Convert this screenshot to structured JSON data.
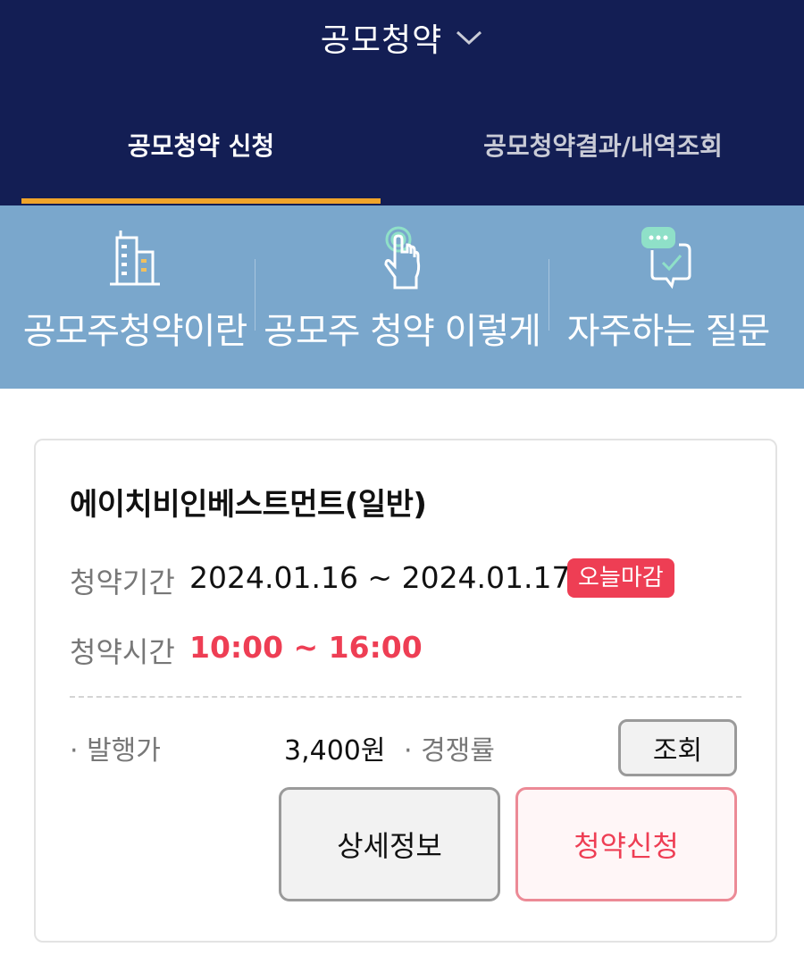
{
  "header": {
    "title": "공모청약",
    "title_icon": "chevron-down-icon",
    "tabs": [
      {
        "label": "공모청약 신청",
        "active": true
      },
      {
        "label": "공모청약결과/내역조회",
        "active": false
      }
    ],
    "accent_color": "#f0a42a",
    "background_color": "#131e54"
  },
  "quick_menu": {
    "background_color": "#7aa7cc",
    "items": [
      {
        "label": "공모주청약이란",
        "icon": "building-icon"
      },
      {
        "label": "공모주 청약 이렇게",
        "icon": "tap-hand-icon"
      },
      {
        "label": "자주하는 질문",
        "icon": "chat-check-icon"
      }
    ]
  },
  "offering": {
    "company": "에이치비인베스트먼트(일반)",
    "period_label": "청약기간",
    "period_value": "2024.01.16 ~ 2024.01.17",
    "badge": "오늘마감",
    "time_label": "청약시간",
    "time_value": "10:00 ~ 16:00",
    "price_label": "· 발행가",
    "price_value": "3,400원",
    "competition_label": "· 경쟁률",
    "query_button": "조회",
    "detail_button": "상세정보",
    "apply_button": "청약신청",
    "highlight_color": "#ee3e54"
  }
}
